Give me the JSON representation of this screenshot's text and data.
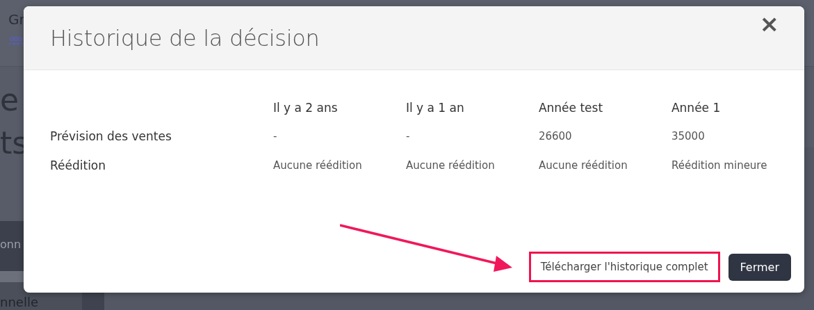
{
  "background": {
    "header_text": "Gr",
    "heading_lines": [
      "e",
      "ts"
    ],
    "menu_items": [
      "onn",
      "nnelle"
    ]
  },
  "modal": {
    "title": "Historique de la décision",
    "close": "×",
    "table": {
      "columns": [
        "Il y a 2 ans",
        "Il y a 1 an",
        "Année test",
        "Année 1"
      ],
      "rows": [
        {
          "label": "Prévision des ventes",
          "values": [
            "-",
            "-",
            "26600",
            "35000"
          ]
        },
        {
          "label": "Réédition",
          "values": [
            "Aucune réédition",
            "Aucune réédition",
            "Aucune réédition",
            "Réédition mineure"
          ]
        }
      ]
    },
    "buttons": [
      {
        "label": "Télécharger l'historique complet",
        "kind": "secondary",
        "highlighted": true
      },
      {
        "label": "Fermer",
        "kind": "primary",
        "highlighted": false
      }
    ]
  }
}
